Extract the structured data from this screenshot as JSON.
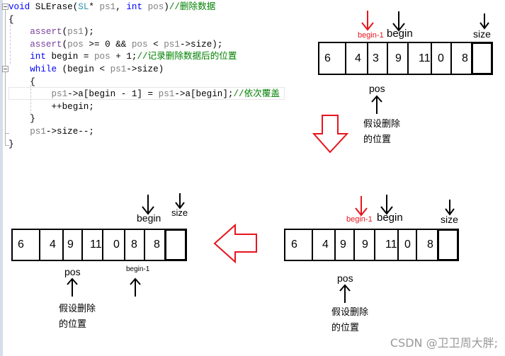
{
  "code": {
    "lines": [
      {
        "parts": [
          {
            "c": "kw",
            "t": "void"
          },
          {
            "c": "plain",
            "t": " SLErase("
          },
          {
            "c": "ty",
            "t": "SL"
          },
          {
            "c": "plain",
            "t": "* "
          },
          {
            "c": "var",
            "t": "ps1"
          },
          {
            "c": "plain",
            "t": ", "
          },
          {
            "c": "kw",
            "t": "int"
          },
          {
            "c": "var",
            "t": " pos"
          },
          {
            "c": "plain",
            "t": ")"
          },
          {
            "c": "cm",
            "t": "//删除数据"
          }
        ]
      },
      {
        "parts": [
          {
            "c": "plain",
            "t": "{"
          }
        ]
      },
      {
        "parts": [
          {
            "c": "plain",
            "t": "    "
          },
          {
            "c": "fn",
            "t": "assert"
          },
          {
            "c": "plain",
            "t": "("
          },
          {
            "c": "var",
            "t": "ps1"
          },
          {
            "c": "plain",
            "t": ");"
          }
        ]
      },
      {
        "parts": [
          {
            "c": "plain",
            "t": "    "
          },
          {
            "c": "fn",
            "t": "assert"
          },
          {
            "c": "plain",
            "t": "("
          },
          {
            "c": "var",
            "t": "pos"
          },
          {
            "c": "plain",
            "t": " >= 0 && "
          },
          {
            "c": "var",
            "t": "pos"
          },
          {
            "c": "plain",
            "t": " < "
          },
          {
            "c": "var",
            "t": "ps1"
          },
          {
            "c": "plain",
            "t": "->size);"
          }
        ]
      },
      {
        "parts": [
          {
            "c": "plain",
            "t": "    "
          },
          {
            "c": "kw",
            "t": "int"
          },
          {
            "c": "plain",
            "t": " begin = "
          },
          {
            "c": "var",
            "t": "pos"
          },
          {
            "c": "plain",
            "t": " + 1;"
          },
          {
            "c": "cm",
            "t": "//记录删除数据后的位置"
          }
        ]
      },
      {
        "parts": [
          {
            "c": "plain",
            "t": "    "
          },
          {
            "c": "kw",
            "t": "while"
          },
          {
            "c": "plain",
            "t": " (begin < "
          },
          {
            "c": "var",
            "t": "ps1"
          },
          {
            "c": "plain",
            "t": "->size)"
          }
        ]
      },
      {
        "parts": [
          {
            "c": "plain",
            "t": "    {"
          }
        ]
      },
      {
        "parts": [
          {
            "c": "plain",
            "t": "        "
          },
          {
            "c": "var",
            "t": "ps1"
          },
          {
            "c": "plain",
            "t": "->a[begin - 1] = "
          },
          {
            "c": "var",
            "t": "ps1"
          },
          {
            "c": "plain",
            "t": "->a[begin];"
          },
          {
            "c": "cm",
            "t": "//依次覆盖"
          }
        ]
      },
      {
        "parts": [
          {
            "c": "plain",
            "t": "        ++begin;"
          }
        ]
      },
      {
        "parts": [
          {
            "c": "plain",
            "t": "    }"
          }
        ]
      },
      {
        "parts": [
          {
            "c": "plain",
            "t": "    "
          },
          {
            "c": "var",
            "t": "ps1"
          },
          {
            "c": "plain",
            "t": "->size--;"
          }
        ]
      },
      {
        "parts": [
          {
            "c": "plain",
            "t": "}"
          }
        ]
      }
    ]
  },
  "arrays": {
    "top": {
      "cells": [
        "6",
        "4",
        "3",
        "9",
        "11",
        "0",
        "8",
        ""
      ],
      "labels": {
        "begin_minus_1": "begin-1",
        "begin": "begin",
        "size": "size",
        "pos": "pos"
      },
      "note": [
        "假设删除",
        "的位置"
      ]
    },
    "middle": {
      "cells": [
        "6",
        "4",
        "9",
        "9",
        "11",
        "0",
        "8",
        ""
      ],
      "labels": {
        "begin_minus_1": "begin-1",
        "begin": "begin",
        "size": "size",
        "pos": "pos"
      },
      "note": [
        "假设删除",
        "的位置"
      ]
    },
    "bottom": {
      "cells": [
        "6",
        "4",
        "9",
        "11",
        "0",
        "8",
        "8",
        ""
      ],
      "labels": {
        "begin_minus_1": "begin-1",
        "begin": "begin",
        "size": "size",
        "pos": "pos"
      },
      "note": [
        "假设删除",
        "的位置"
      ]
    }
  },
  "colors": {
    "highlight": "#e8141c",
    "ink": "#000000"
  },
  "watermark": "CSDN @卫卫周大胖;"
}
